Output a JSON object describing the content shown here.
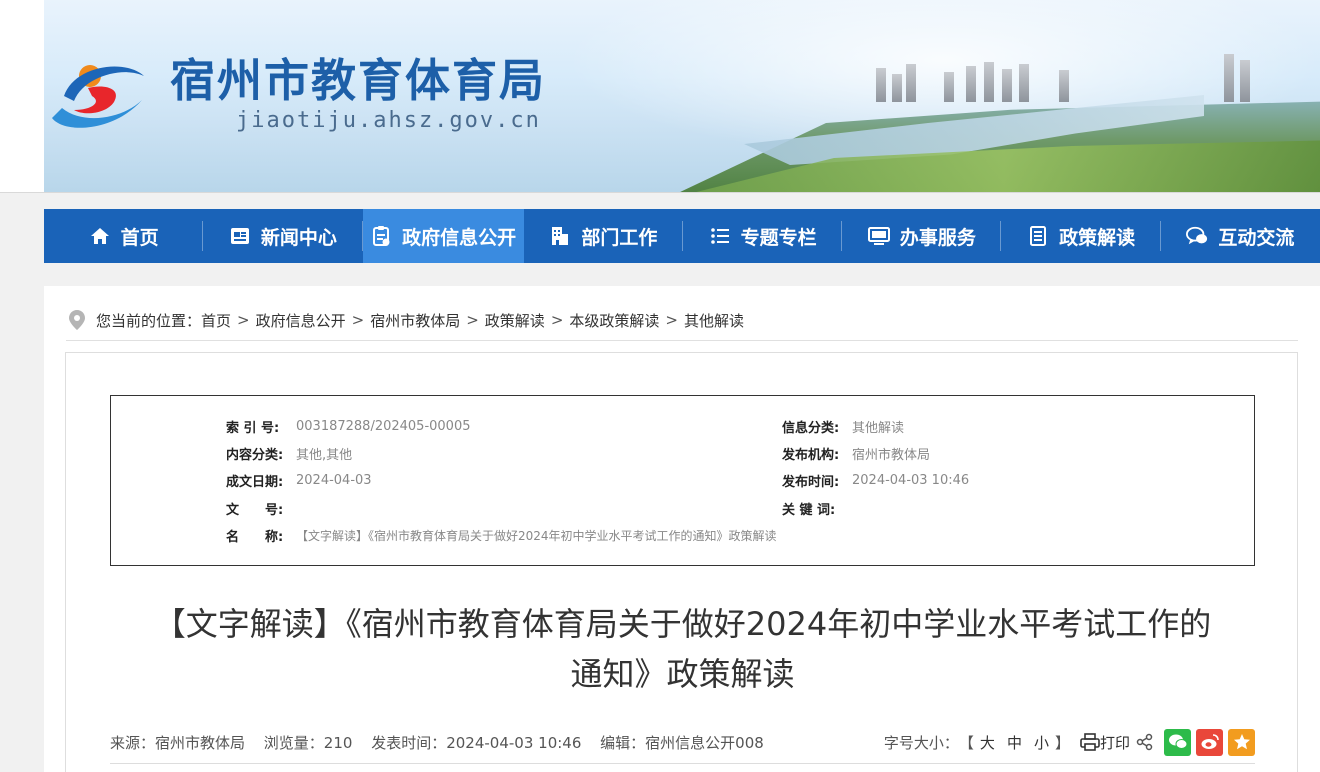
{
  "site": {
    "title": "宿州市教育体育局",
    "url": "jiaotiju.ahsz.gov.cn"
  },
  "nav": {
    "items": [
      {
        "label": "首页",
        "icon": "home-icon"
      },
      {
        "label": "新闻中心",
        "icon": "news-icon"
      },
      {
        "label": "政府信息公开",
        "icon": "clipboard-icon",
        "active": true
      },
      {
        "label": "部门工作",
        "icon": "building-icon"
      },
      {
        "label": "专题专栏",
        "icon": "list-icon"
      },
      {
        "label": "办事服务",
        "icon": "monitor-icon"
      },
      {
        "label": "政策解读",
        "icon": "document-icon"
      },
      {
        "label": "互动交流",
        "icon": "chat-icon"
      }
    ]
  },
  "breadcrumb": {
    "prefix": "您当前的位置：",
    "items": [
      "首页",
      "政府信息公开",
      "宿州市教体局",
      "政策解读",
      "本级政策解读",
      "其他解读"
    ],
    "separator": ">"
  },
  "meta": {
    "index_label": "索 引 号:",
    "index_value": "003187288/202405-00005",
    "info_category_label": "信息分类:",
    "info_category_value": "其他解读",
    "content_category_label": "内容分类:",
    "content_category_value": "其他,其他",
    "publisher_label": "发布机构:",
    "publisher_value": "宿州市教体局",
    "date_label": "成文日期:",
    "date_value": "2024-04-03",
    "publish_time_label": "发布时间:",
    "publish_time_value": "2024-04-03 10:46",
    "doc_no_label": "文　　号:",
    "doc_no_value": "",
    "keywords_label": "关 键 词:",
    "keywords_value": "",
    "name_label": "名　　称:",
    "name_value": "【文字解读】《宿州市教育体育局关于做好2024年初中学业水平考试工作的通知》政策解读"
  },
  "article": {
    "title_line1": "【文字解读】《宿州市教育体育局关于做好2024年初中学业水平考试工作的",
    "title_line2": "通知》政策解读"
  },
  "info": {
    "source": "来源：宿州市教体局",
    "views": "浏览量：210",
    "publish_time": "发表时间：2024-04-03 10:46",
    "editor": "编辑：宿州信息公开008",
    "font_size_label": "字号大小：",
    "bracket_open": "【",
    "size_large": "大",
    "size_medium": "中",
    "size_small": "小",
    "bracket_close": "】",
    "print_label": "打印"
  },
  "colors": {
    "nav_bg": "#1a63b8",
    "nav_active": "#3a8be0",
    "title_blue": "#1d5fa8",
    "wechat": "#2dbb4a",
    "weibo": "#e9473a",
    "favorite": "#f29c1f"
  }
}
